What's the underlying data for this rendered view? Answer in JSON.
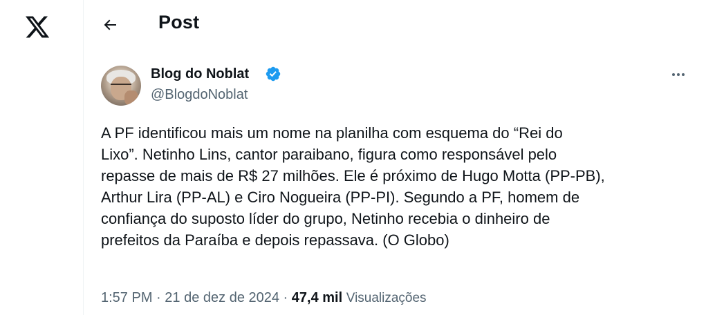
{
  "header": {
    "title": "Post"
  },
  "post": {
    "author": {
      "name": "Blog do Noblat",
      "handle": "@BlogdoNoblat",
      "verified": true
    },
    "lines": [
      "A PF identificou mais um nome na planilha com esquema do “Rei do",
      "Lixo”. Netinho Lins, cantor paraibano, figura como responsável pelo",
      "repasse de mais de R$ 27 milhões. Ele é próximo de Hugo Motta (PP-PB),",
      "Arthur Lira (PP-AL) e Ciro Nogueira (PP-PI). Segundo a PF, homem de",
      "confiança do suposto líder do grupo, Netinho recebia o dinheiro de",
      "prefeitos da Paraíba e depois repassava. (O Globo)"
    ],
    "time": "1:57 PM",
    "date": "21 de dez de 2024",
    "separator": "·",
    "views_count": "47,4 mil",
    "views_label": "Visualizações"
  },
  "colors": {
    "text": "#0f1419",
    "secondary": "#536471",
    "verified": "#1d9bf0",
    "border": "#eff3f4"
  },
  "icons": [
    "x-logo-icon",
    "back-arrow-icon",
    "verified-badge-icon",
    "more-options-icon"
  ]
}
